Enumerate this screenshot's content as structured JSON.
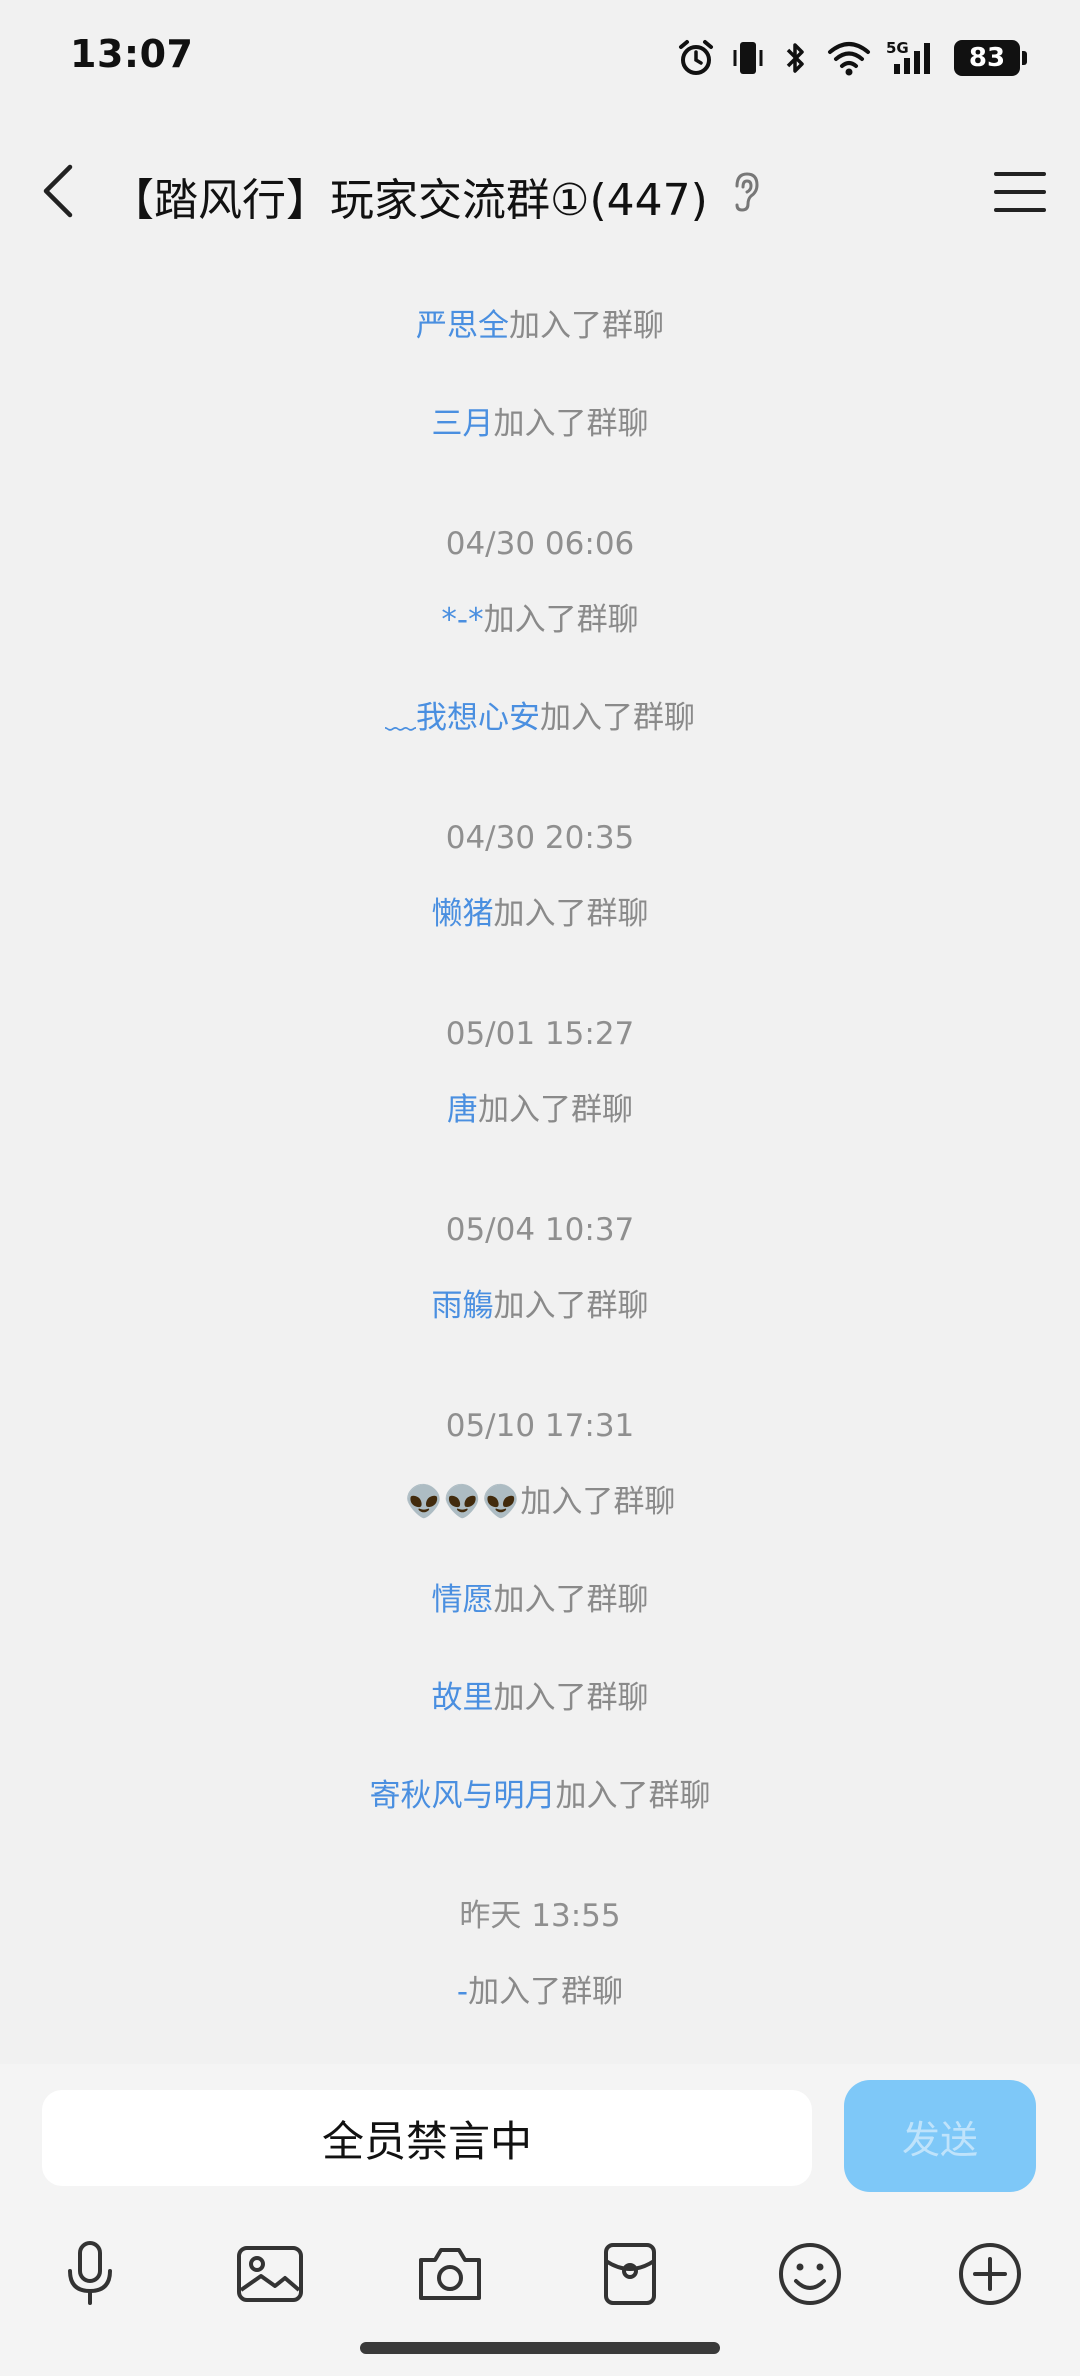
{
  "status_bar": {
    "time": "13:07",
    "network": "5G",
    "battery": "83"
  },
  "header": {
    "title": "【踏风行】玩家交流群①(447)"
  },
  "messages": [
    {
      "type": "join",
      "name": "严思全",
      "text": "加入了群聊"
    },
    {
      "type": "join",
      "name": "三月",
      "text": "加入了群聊"
    },
    {
      "type": "time",
      "text": "04/30 06:06"
    },
    {
      "type": "join",
      "name": "*-*",
      "text": "加入了群聊"
    },
    {
      "type": "join",
      "name": "﹏我想心安",
      "text": "加入了群聊"
    },
    {
      "type": "time",
      "text": "04/30 20:35"
    },
    {
      "type": "join",
      "name": "懒猪",
      "text": "加入了群聊"
    },
    {
      "type": "time",
      "text": "05/01 15:27"
    },
    {
      "type": "join",
      "name": "唐",
      "text": "加入了群聊"
    },
    {
      "type": "time",
      "text": "05/04 10:37"
    },
    {
      "type": "join",
      "name": "雨觴",
      "text": "加入了群聊"
    },
    {
      "type": "time",
      "text": "05/10 17:31"
    },
    {
      "type": "join",
      "name": "👽👽👽",
      "text": "加入了群聊"
    },
    {
      "type": "join",
      "name": "情愿",
      "text": "加入了群聊"
    },
    {
      "type": "join",
      "name": "故里",
      "text": "加入了群聊"
    },
    {
      "type": "join",
      "name": "寄秋风与明月",
      "text": "加入了群聊"
    },
    {
      "type": "time",
      "text": "昨天 13:55"
    },
    {
      "type": "join",
      "name": "-",
      "text": "加入了群聊"
    }
  ],
  "input": {
    "placeholder": "全员禁言中",
    "send_label": "发送"
  },
  "toolbar_icons": [
    "mic-icon",
    "image-icon",
    "camera-icon",
    "red-packet-icon",
    "emoji-icon",
    "plus-icon"
  ]
}
